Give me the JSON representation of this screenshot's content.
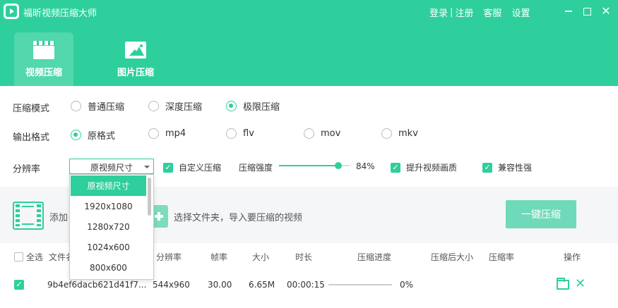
{
  "app": {
    "title": "福昕视频压缩大师"
  },
  "top_links": {
    "login": "登录",
    "separator": "|",
    "register": "注册",
    "service": "客服",
    "settings": "设置"
  },
  "window": {
    "close": "✕"
  },
  "tabs": [
    {
      "label": "视频压缩",
      "active": true
    },
    {
      "label": "图片压缩",
      "active": false
    }
  ],
  "compress_mode": {
    "label": "压缩模式",
    "options": [
      "普通压缩",
      "深度压缩",
      "极限压缩"
    ],
    "selected": "极限压缩"
  },
  "output_format": {
    "label": "输出格式",
    "options": [
      "原格式",
      "mp4",
      "flv",
      "mov",
      "mkv"
    ],
    "selected": "原格式"
  },
  "resolution": {
    "label": "分辨率",
    "selected": "原视频尺寸",
    "options": [
      "原视频尺寸",
      "1920x1080",
      "1280x720",
      "1024x600",
      "800x600"
    ]
  },
  "custom_compress": {
    "label": "自定义压缩",
    "checked": true
  },
  "strength": {
    "label": "压缩强度",
    "value_text": "84%",
    "value": 0.84
  },
  "enhance_quality": {
    "label": "提升视频画质",
    "checked": true
  },
  "compatibility": {
    "label": "兼容性强",
    "checked": true
  },
  "drop_area": {
    "add_text": "添加",
    "folder_text": "选择文件夹，导入要压缩的视频",
    "compress_button": "一键压缩"
  },
  "table": {
    "select_all": "全选",
    "columns": [
      "文件名",
      "分辨率",
      "帧率",
      "大小",
      "时长",
      "压缩进度",
      "压缩后大小",
      "压缩率",
      "操作"
    ],
    "rows": [
      {
        "checked": true,
        "filename": "9b4ef6dacb621d41f7...",
        "resolution": "544x960",
        "fps": "30.00",
        "size": "6.65M",
        "duration": "00:00:15",
        "progress_text": "0%",
        "progress": 0
      }
    ]
  },
  "colors": {
    "accent": "#2ecf9c",
    "button": "#6fd9b9"
  },
  "icons": {
    "check": "✓"
  }
}
